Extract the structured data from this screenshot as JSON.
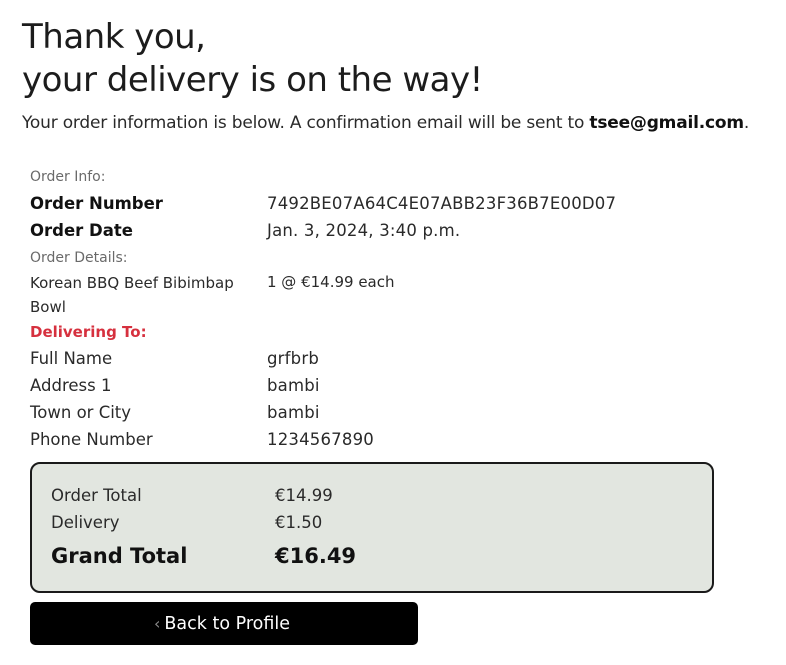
{
  "header": {
    "line1": "Thank you,",
    "line2": "your delivery is on the way!"
  },
  "intro": {
    "text": "Your order information is below. A confirmation email will be sent to ",
    "email": "tsee@gmail.com",
    "suffix": "."
  },
  "order_info": {
    "section_label": "Order Info:",
    "number_label": "Order Number",
    "number_value": "7492BE07A64C4E07ABB23F36B7E00D07",
    "date_label": "Order Date",
    "date_value": "Jan. 3, 2024, 3:40 p.m."
  },
  "order_details": {
    "section_label": "Order Details:",
    "items": [
      {
        "name": "Korean BBQ Beef Bibimbap Bowl",
        "quantity": "1 @ €14.99 each"
      }
    ]
  },
  "delivery": {
    "section_label": "Delivering To:",
    "fields": [
      {
        "label": "Full Name",
        "value": "grfbrb"
      },
      {
        "label": "Address 1",
        "value": "bambi"
      },
      {
        "label": "Town or City",
        "value": "bambi"
      },
      {
        "label": "Phone Number",
        "value": "1234567890"
      }
    ]
  },
  "totals": {
    "order_total_label": "Order Total",
    "order_total_value": "€14.99",
    "delivery_label": "Delivery",
    "delivery_value": "€1.50",
    "grand_total_label": "Grand Total",
    "grand_total_value": "€16.49"
  },
  "actions": {
    "back_label": "Back to Profile",
    "back_icon": "chevron-left-icon"
  },
  "colors": {
    "accent_red": "#d6303e",
    "totals_bg": "#e2e6e0",
    "button_bg": "#000000"
  }
}
